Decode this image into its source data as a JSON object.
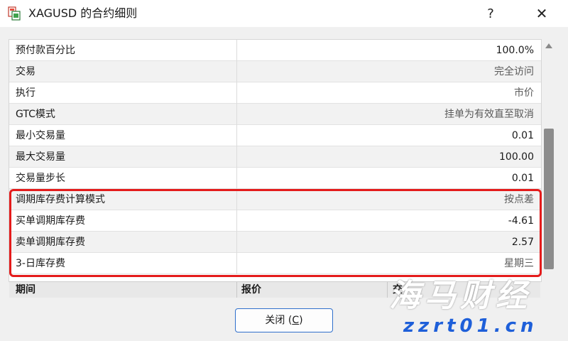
{
  "window": {
    "title": "XAGUSD 的合约细则",
    "help_glyph": "?",
    "close_glyph": "✕"
  },
  "icons": {
    "app": "document-icon",
    "help": "question-icon",
    "close": "close-icon"
  },
  "colors": {
    "highlight": "#e41b1b",
    "button_border": "#2f6fcc",
    "watermark_site": "#1e5fd9"
  },
  "rows": [
    {
      "name": "预付款百分比",
      "value": "100.0%"
    },
    {
      "name": "交易",
      "value": "完全访问"
    },
    {
      "name": "执行",
      "value": "市价"
    },
    {
      "name": "GTC模式",
      "value": "挂单为有效直至取消"
    },
    {
      "name": "最小交易量",
      "value": "0.01"
    },
    {
      "name": "最大交易量",
      "value": "100.00"
    },
    {
      "name": "交易量步长",
      "value": "0.01"
    },
    {
      "name": "调期库存费计算模式",
      "value": "按点差"
    },
    {
      "name": "买单调期库存费",
      "value": "-4.61"
    },
    {
      "name": "卖单调期库存费",
      "value": "2.57"
    },
    {
      "name": "3-日库存费",
      "value": "星期三"
    }
  ],
  "table_header": {
    "col1": "期间",
    "col2": "报价",
    "col3": "交"
  },
  "footer": {
    "close_label": "关闭 (",
    "close_mnemonic": "C",
    "close_suffix": ")"
  },
  "watermark": {
    "main": "海马财经",
    "site": "zzrt01.cn"
  }
}
